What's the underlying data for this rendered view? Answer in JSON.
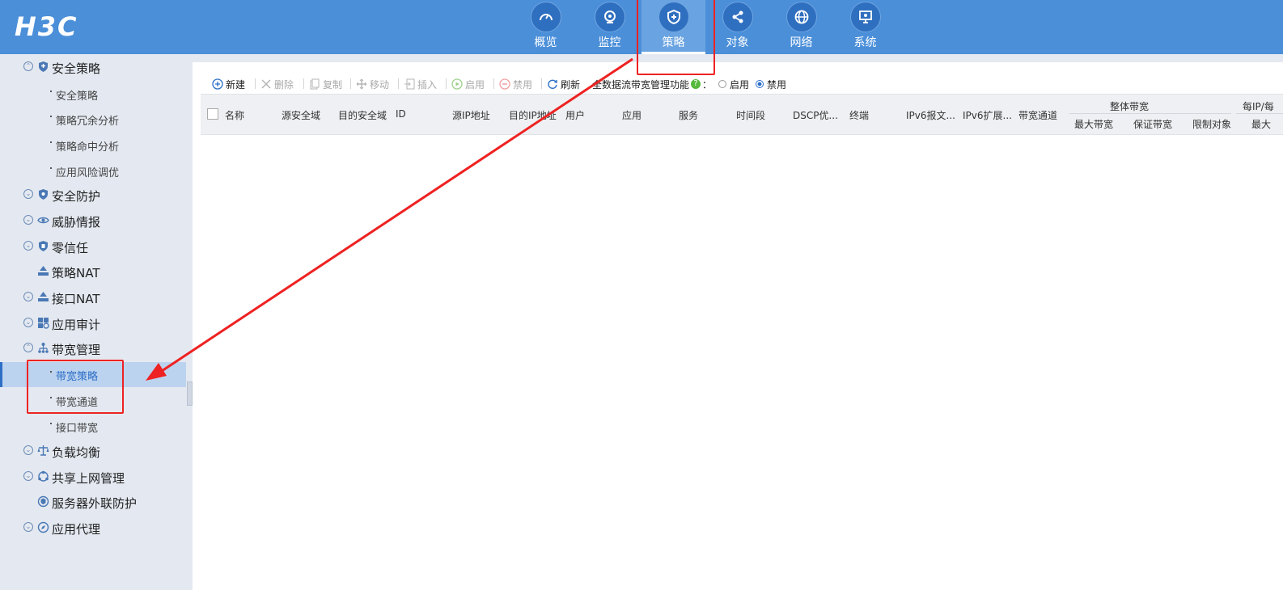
{
  "brand": {
    "logo": "H3C"
  },
  "topnav": [
    {
      "label": "概览",
      "icon": "dashboard-icon"
    },
    {
      "label": "监控",
      "icon": "monitor-camera-icon"
    },
    {
      "label": "策略",
      "icon": "shield-plus-icon",
      "active": true
    },
    {
      "label": "对象",
      "icon": "share-nodes-icon"
    },
    {
      "label": "网络",
      "icon": "globe-icon"
    },
    {
      "label": "系统",
      "icon": "system-monitor-icon"
    }
  ],
  "sidebar": {
    "items": [
      {
        "label": "安全策略",
        "level": 1,
        "icon": "shield-icon"
      },
      {
        "label": "安全策略",
        "level": 2
      },
      {
        "label": "策略冗余分析",
        "level": 2
      },
      {
        "label": "策略命中分析",
        "level": 2
      },
      {
        "label": "应用风险调优",
        "level": 2
      },
      {
        "label": "安全防护",
        "level": 1,
        "icon": "shield-icon"
      },
      {
        "label": "威胁情报",
        "level": 1,
        "icon": "eye-icon"
      },
      {
        "label": "零信任",
        "level": 1,
        "icon": "shield-icon"
      },
      {
        "label": "策略NAT",
        "level": 1,
        "icon": "nat-icon"
      },
      {
        "label": "接口NAT",
        "level": 1,
        "icon": "nat-icon"
      },
      {
        "label": "应用审计",
        "level": 1,
        "icon": "grid-audit-icon"
      },
      {
        "label": "带宽管理",
        "level": 1,
        "icon": "org-chart-icon"
      },
      {
        "label": "带宽策略",
        "level": 2,
        "selected": true
      },
      {
        "label": "带宽通道",
        "level": 2
      },
      {
        "label": "接口带宽",
        "level": 2
      },
      {
        "label": "负载均衡",
        "level": 1,
        "icon": "balance-icon"
      },
      {
        "label": "共享上网管理",
        "level": 1,
        "icon": "share-icon"
      },
      {
        "label": "服务器外联防护",
        "level": 1,
        "icon": "server-guard-icon"
      },
      {
        "label": "应用代理",
        "level": 1,
        "icon": "compass-icon"
      }
    ]
  },
  "toolbar": {
    "new": "新建",
    "delete": "删除",
    "copy": "复制",
    "move": "移动",
    "insert": "插入",
    "enable": "启用",
    "disable": "禁用",
    "refresh": "刷新",
    "global_label": "全数据流带宽管理功能",
    "colon": "：",
    "opt_enable": "启用",
    "opt_disable": "禁用",
    "selected_option": "禁用"
  },
  "table": {
    "columns": [
      "名称",
      "源安全域",
      "目的安全域",
      "ID",
      "源IP地址",
      "目的IP地址",
      "用户",
      "应用",
      "服务",
      "时间段",
      "DSCP优...",
      "终端",
      "IPv6报文...",
      "IPv6扩展...",
      "带宽通道"
    ],
    "group1": {
      "title": "整体带宽",
      "sub": [
        "最大带宽",
        "保证带宽",
        "限制对象"
      ]
    },
    "group2": {
      "title": "每IP/每",
      "sub": [
        "最大"
      ]
    }
  },
  "colors": {
    "topbar": "#4b8fd9",
    "active_nav": "#6aa3e1",
    "sidebar": "#e4e9f1",
    "selected": "#bcd3ef",
    "annotation": "#ee2222"
  }
}
